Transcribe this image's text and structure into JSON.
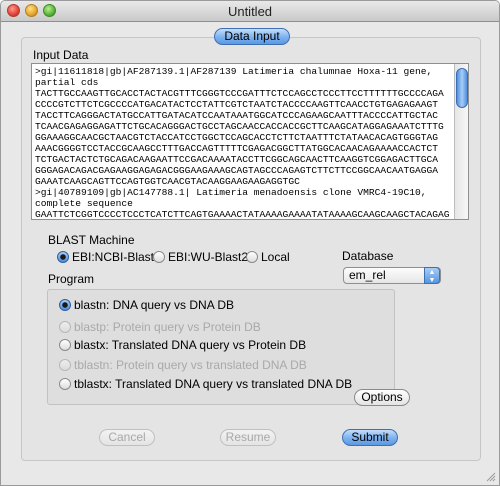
{
  "window": {
    "title": "Untitled"
  },
  "tab": {
    "label": "Data Input"
  },
  "input": {
    "label": "Input Data",
    "text": ">gi|11611818|gb|AF287139.1|AF287139 Latimeria chalumnae Hoxa-11 gene,\npartial cds\nTACTTGCCAAGTTGCACCTACTACGTTTCGGGTCCCGATTTCTCCAGCCTCCCTTCCTTTTTTGCCCCAGA\nCCCCGTCTTCTCGCCCCATGACATACTCCTATTCGTCTAATCTACCCCAAGTTCAACCTGTGAGAGAAGT\nTACCTTCAGGGACTATGCCATTGATACATCCAATAAATGGCATCCCAGAAGCAATTTACCCCATTGCTAC\nTCAACGAGAGGAGATTCTGCACAGGGACTGCCTAGCAACCACCACCGCTTCAAGCATAGGAGAAATCTTTG\nGGAAAGGCAACGCTAACGTCTACCATCCTGGCTCCAGCACCTCTTCTAATTTCTATAACACAGTGGGTAG\nAAACGGGGTCCTACCGCAAGCCTTTGACCAGTTTTTCGAGACGGCTTATGGCACAACAGAAAACCACTCT\nTCTGACTACTCTGCAGACAAGAATTCCGACAAAATACCTTCGGCAGCAACTTCAAGGTCGGAGACTTGCA\nGGGAGACAGACGAGAAGGAGAGACGGGAAGAAAGCAGTAGCCCAGAGTCTTCTTCCGGCAACAATGAGGA\nGAAATCAAGCAGTTCCAGTGGTCAACGTACAAGGAAGAAGAGGTGC\n>gi|40789109|gb|AC147788.1| Latimeria menadoensis clone VMRC4-19C10,\ncomplete sequence\nGAATTCTCGGTCCCCTCCCTCATCTTCAGTGAAAACTATAAAAGAAAATATAAAAGCAAGCAAGCTACAGAG\nTCACCATAATCCATAAAACCAACCTGAATCAGAGAACAAATGCAACACAACTACAACATAACTCCTTC"
  },
  "blast_machine": {
    "label": "BLAST Machine",
    "options": [
      "EBI:NCBI-Blast",
      "EBI:WU-Blast2",
      "Local"
    ],
    "selected": "EBI:NCBI-Blast"
  },
  "database": {
    "label": "Database",
    "value": "em_rel"
  },
  "program": {
    "label": "Program",
    "options": [
      "blastn: DNA query vs DNA DB",
      "blastp: Protein query vs Protein DB",
      "blastx: Translated DNA query vs Protein DB",
      "tblastn: Protein query vs translated DNA DB",
      "tblastx: Translated DNA query vs translated DNA DB"
    ],
    "selected": "blastn: DNA query vs DNA DB"
  },
  "buttons": {
    "options": "Options",
    "cancel": "Cancel",
    "resume": "Resume",
    "submit": "Submit"
  },
  "colors": {
    "accent": "#5b99e2"
  }
}
